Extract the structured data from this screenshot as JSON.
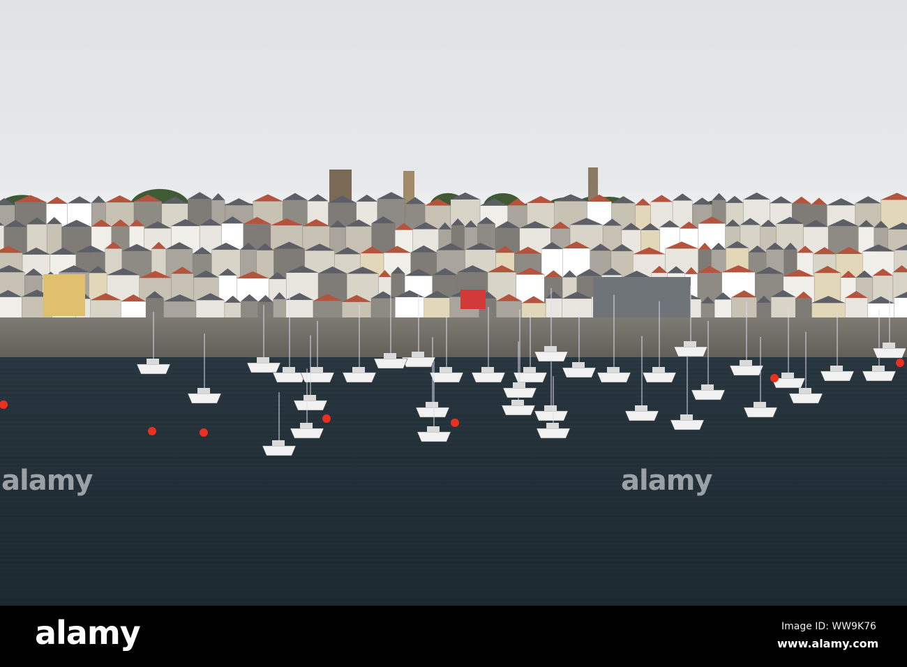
{
  "watermark": {
    "brand": "alamy"
  },
  "footer": {
    "logo": "alamy",
    "image_id": "Image ID: WW9K76",
    "url": "www.alamy.com"
  }
}
